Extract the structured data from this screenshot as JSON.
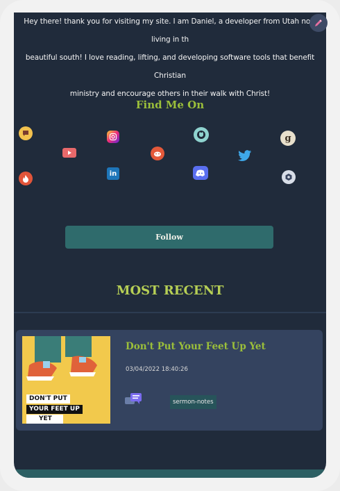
{
  "intro": {
    "line1": "Hey there! thank you for visiting my site. I am Daniel, a developer from Utah now living in th",
    "line2": "beautiful south! I love reading, lifting, and developing software tools that benefit Christian",
    "line3": "ministry and encourage others in their walk with Christ!"
  },
  "find_me": {
    "title": "Find Me On",
    "links": [
      {
        "icon": "chat-bubble-icon"
      },
      {
        "icon": "youtube-icon"
      },
      {
        "icon": "instagram-icon"
      },
      {
        "icon": "linkedin-icon"
      },
      {
        "icon": "reddit-icon"
      },
      {
        "icon": "github-icon"
      },
      {
        "icon": "discord-icon"
      },
      {
        "icon": "twitter-icon"
      },
      {
        "icon": "goodreads-icon"
      },
      {
        "icon": "hexagon-icon"
      },
      {
        "icon": "fire-icon"
      }
    ]
  },
  "follow_label": "Follow",
  "most_recent": {
    "title": "MOST RECENT",
    "post": {
      "title": "Don't Put Your Feet Up Yet",
      "date": "03/04/2022 18:40:26",
      "tag": "sermon-notes",
      "thumb_caption": [
        "DON'T PUT",
        "YOUR FEET UP",
        "YET"
      ]
    }
  },
  "colors": {
    "background": "#202b3b",
    "accent": "#9bbf3a",
    "button": "#2f6b6c",
    "card": "#34435f"
  }
}
